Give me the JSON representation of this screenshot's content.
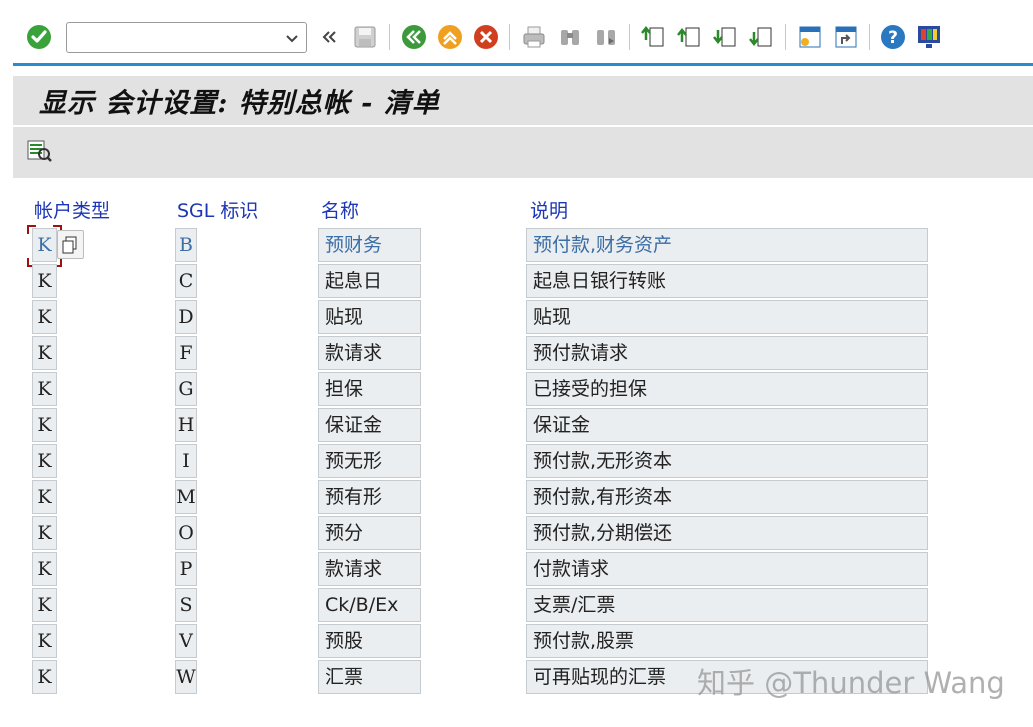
{
  "toolbar": {
    "command_field": {
      "value": "",
      "placeholder": ""
    },
    "buttons": [
      "enter-icon",
      "back-nav-icon",
      "save-icon",
      "back-icon",
      "exit-icon",
      "cancel-icon",
      "print-icon",
      "find-icon",
      "find-next-icon",
      "first-page-icon",
      "previous-page-icon",
      "next-page-icon",
      "last-page-icon",
      "create-session-icon",
      "shortcut-icon",
      "help-icon",
      "customize-layout-icon"
    ]
  },
  "title": "显示 会计设置: 特别总帐 - 清单",
  "app_toolbar": {
    "icon": "details-icon"
  },
  "table": {
    "headers": {
      "account_type": "帐户类型",
      "sgl_indicator": "SGL 标识",
      "name": "名称",
      "description": "说明"
    },
    "rows": [
      {
        "account_type": "K",
        "sgl": "B",
        "name": "预财务",
        "description": "预付款,财务资产"
      },
      {
        "account_type": "K",
        "sgl": "C",
        "name": "起息日",
        "description": "起息日银行转账"
      },
      {
        "account_type": "K",
        "sgl": "D",
        "name": "贴现",
        "description": "贴现"
      },
      {
        "account_type": "K",
        "sgl": "F",
        "name": "款请求",
        "description": "预付款请求"
      },
      {
        "account_type": "K",
        "sgl": "G",
        "name": "担保",
        "description": "已接受的担保"
      },
      {
        "account_type": "K",
        "sgl": "H",
        "name": "保证金",
        "description": "保证金"
      },
      {
        "account_type": "K",
        "sgl": "I",
        "name": "预无形",
        "description": "预付款,无形资本"
      },
      {
        "account_type": "K",
        "sgl": "M",
        "name": "预有形",
        "description": "预付款,有形资本"
      },
      {
        "account_type": "K",
        "sgl": "O",
        "name": "预分",
        "description": "预付款,分期偿还"
      },
      {
        "account_type": "K",
        "sgl": "P",
        "name": "款请求",
        "description": "付款请求"
      },
      {
        "account_type": "K",
        "sgl": "S",
        "name": "Ck/B/Ex",
        "description": "支票/汇票"
      },
      {
        "account_type": "K",
        "sgl": "V",
        "name": "预股",
        "description": "预付款,股票"
      },
      {
        "account_type": "K",
        "sgl": "W",
        "name": "汇票",
        "description": "可再贴现的汇票"
      }
    ]
  },
  "watermark": "知乎 @Thunder Wang",
  "colors": {
    "accent_line": "#2a8cd0",
    "header_text": "#1c36b5",
    "bar_bg": "#e2e2e2",
    "cell_bg": "#ebeef1"
  }
}
